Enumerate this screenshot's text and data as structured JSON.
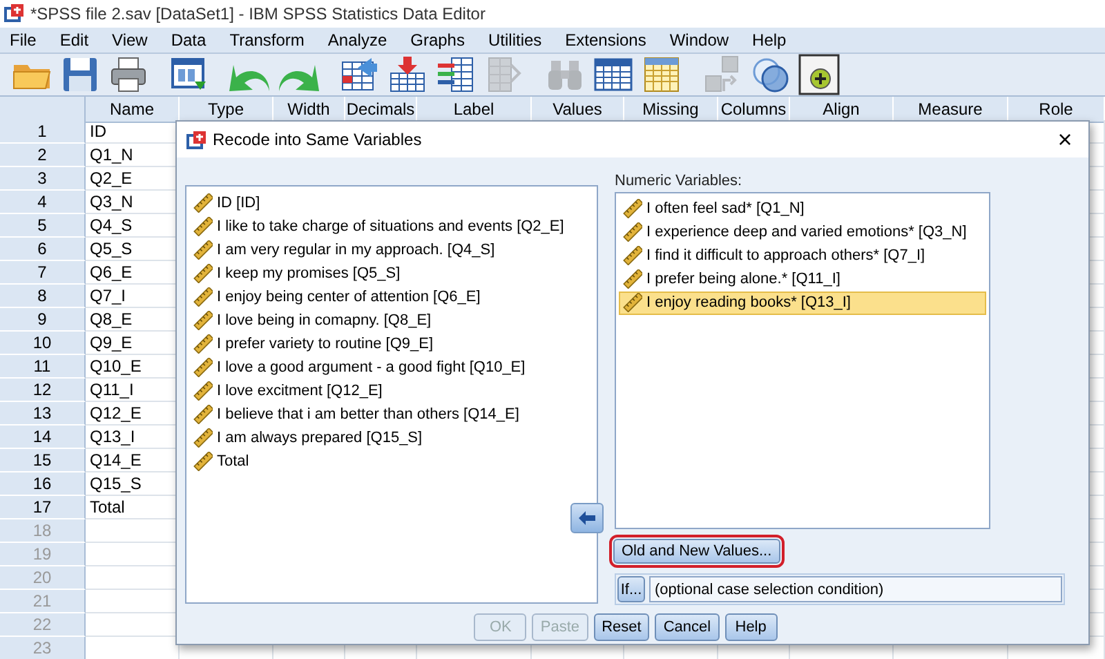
{
  "window": {
    "title": "*SPSS file 2.sav [DataSet1] - IBM SPSS Statistics Data Editor"
  },
  "menu": [
    "File",
    "Edit",
    "View",
    "Data",
    "Transform",
    "Analyze",
    "Graphs",
    "Utilities",
    "Extensions",
    "Window",
    "Help"
  ],
  "toolbar": [
    {
      "kind": "open",
      "disabled": false
    },
    {
      "kind": "save",
      "disabled": false
    },
    {
      "kind": "print",
      "disabled": false
    },
    {
      "kind": "recall",
      "disabled": false
    },
    {
      "kind": "undo",
      "disabled": false
    },
    {
      "kind": "redo",
      "disabled": false
    },
    {
      "kind": "gotocase",
      "disabled": false
    },
    {
      "kind": "gotovar",
      "disabled": false
    },
    {
      "kind": "variables",
      "disabled": false
    },
    {
      "kind": "runscript",
      "disabled": true
    },
    {
      "kind": "find",
      "disabled": true
    },
    {
      "kind": "insertcases",
      "disabled": false
    },
    {
      "kind": "insertvar",
      "disabled": false
    },
    {
      "kind": "split",
      "disabled": true
    },
    {
      "kind": "weight",
      "disabled": false
    },
    {
      "kind": "addon",
      "disabled": false
    }
  ],
  "table": {
    "columns": [
      "Name",
      "Type",
      "Width",
      "Decimals",
      "Label",
      "Values",
      "Missing",
      "Columns",
      "Align",
      "Measure",
      "Role"
    ],
    "rows": [
      {
        "number": "1",
        "name": "ID"
      },
      {
        "number": "2",
        "name": "Q1_N"
      },
      {
        "number": "3",
        "name": "Q2_E"
      },
      {
        "number": "4",
        "name": "Q3_N"
      },
      {
        "number": "5",
        "name": "Q4_S"
      },
      {
        "number": "6",
        "name": "Q5_S"
      },
      {
        "number": "7",
        "name": "Q6_E"
      },
      {
        "number": "8",
        "name": "Q7_I"
      },
      {
        "number": "9",
        "name": "Q8_E"
      },
      {
        "number": "10",
        "name": "Q9_E"
      },
      {
        "number": "11",
        "name": "Q10_E"
      },
      {
        "number": "12",
        "name": "Q11_I"
      },
      {
        "number": "13",
        "name": "Q12_E"
      },
      {
        "number": "14",
        "name": "Q13_I"
      },
      {
        "number": "15",
        "name": "Q14_E"
      },
      {
        "number": "16",
        "name": "Q15_S"
      },
      {
        "number": "17",
        "name": "Total"
      },
      {
        "number": "18"
      },
      {
        "number": "19"
      },
      {
        "number": "20"
      },
      {
        "number": "21"
      },
      {
        "number": "22"
      },
      {
        "number": "23"
      }
    ]
  },
  "dialog": {
    "title": "Recode into Same Variables",
    "close": "×",
    "source_variables": [
      {
        "label": "ID [ID]",
        "selected": false
      },
      {
        "label": "I like to take charge of situations and events [Q2_E]",
        "selected": false
      },
      {
        "label": "I am very regular in my approach. [Q4_S]",
        "selected": false
      },
      {
        "label": "I keep my promises [Q5_S]",
        "selected": false
      },
      {
        "label": "I enjoy being center of attention [Q6_E]",
        "selected": false
      },
      {
        "label": "I love being in comapny. [Q8_E]",
        "selected": false
      },
      {
        "label": "I prefer variety to routine [Q9_E]",
        "selected": false
      },
      {
        "label": "I love a good argument - a good fight [Q10_E]",
        "selected": false
      },
      {
        "label": "I love excitment [Q12_E]",
        "selected": false
      },
      {
        "label": "I believe that i am better than others  [Q14_E]",
        "selected": false
      },
      {
        "label": "I am always prepared [Q15_S]",
        "selected": false
      },
      {
        "label": "Total",
        "selected": false
      }
    ],
    "numeric_variables_label": "Numeric Variables:",
    "numeric_variables": [
      {
        "label": "I often feel sad* [Q1_N]",
        "selected": false
      },
      {
        "label": "I experience deep and varied emotions* [Q3_N]",
        "selected": false
      },
      {
        "label": "I find it difficult to approach others* [Q7_I]",
        "selected": false
      },
      {
        "label": "I prefer being alone.* [Q11_I]",
        "selected": false
      },
      {
        "label": "I enjoy reading books* [Q13_I]",
        "selected": true
      }
    ],
    "old_new_button": {
      "label": "Old and New Values...",
      "highlighted": true
    },
    "if_button": "If...",
    "condition_field": {
      "value": "(optional case selection condition)"
    },
    "buttons": [
      {
        "label": "OK",
        "disabled": true
      },
      {
        "label": "Paste",
        "disabled": true
      },
      {
        "label": "Reset",
        "disabled": false
      },
      {
        "label": "Cancel",
        "disabled": false
      },
      {
        "label": "Help",
        "disabled": false
      }
    ]
  }
}
